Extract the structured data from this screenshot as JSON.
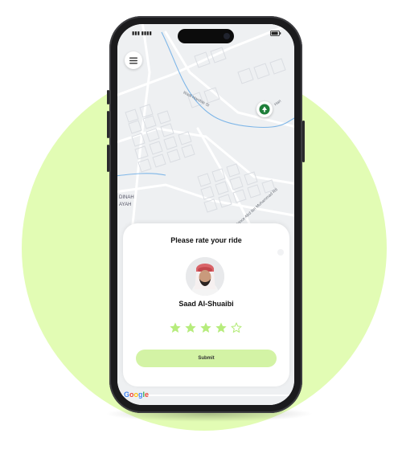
{
  "screen": {
    "map_labels": {
      "district_line1": "DINAH",
      "district_line2": "AYAH",
      "street_1": "Wadi Hanifah St",
      "street_2": "Han",
      "street_3": "Prince Abd Ibn Muhammad Rd"
    },
    "rating_sheet": {
      "title": "Please rate your ride",
      "driver_name": "Saad Al-Shuaibi",
      "rating": 4,
      "max_rating": 5,
      "submit_label": "Submit"
    },
    "map_attribution": "Google"
  },
  "colors": {
    "accent": "#d3f3a5",
    "background_circle": "#e2fcb4",
    "star_filled": "#b6ec7c",
    "star_empty": "#b6ec7c",
    "pin": "#1f7f3a"
  },
  "icons": {
    "menu": "hamburger-icon",
    "pin": "location-pin-icon",
    "star": "star-icon"
  }
}
